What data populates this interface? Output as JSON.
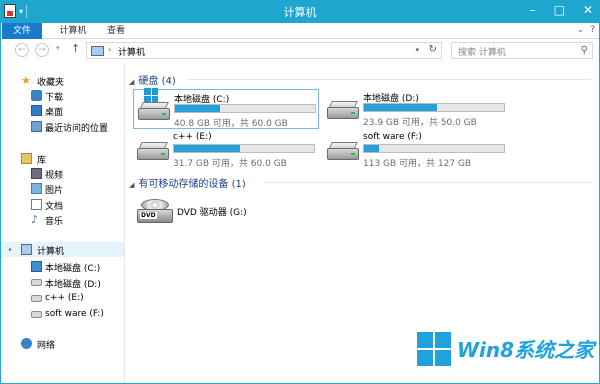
{
  "window": {
    "title": "计算机"
  },
  "ribbon": {
    "tabs": [
      "文件",
      "计算机",
      "查看"
    ]
  },
  "address": {
    "location": "计算机",
    "search_placeholder": "搜索 计算机"
  },
  "nav": {
    "favorites": {
      "label": "收藏夹",
      "items": [
        "下载",
        "桌面",
        "最近访问的位置"
      ]
    },
    "libraries": {
      "label": "库",
      "items": [
        "视频",
        "图片",
        "文档",
        "音乐"
      ]
    },
    "computer": {
      "label": "计算机",
      "items": [
        "本地磁盘 (C:)",
        "本地磁盘 (D:)",
        "c++ (E:)",
        "soft ware (F:)"
      ]
    },
    "network": {
      "label": "网络"
    }
  },
  "groups": {
    "hdd": {
      "label": "硬盘 (4)"
    },
    "removable": {
      "label": "有可移动存储的设备 (1)"
    }
  },
  "drives": [
    {
      "name": "本地磁盘 (C:)",
      "free": "40.8 GB 可用，共 60.0 GB",
      "used_fraction": 0.32
    },
    {
      "name": "本地磁盘 (D:)",
      "free": "23.9 GB 可用，共 50.0 GB",
      "used_fraction": 0.52
    },
    {
      "name": "c++ (E:)",
      "free": "31.7 GB 可用，共 60.0 GB",
      "used_fraction": 0.47
    },
    {
      "name": "soft ware (F:)",
      "free": "113 GB 可用，共 127 GB",
      "used_fraction": 0.11
    }
  ],
  "dvd": {
    "name": "DVD 驱动器 (G:)",
    "badge": "DVD"
  },
  "watermark": {
    "text": "Win8系统之家"
  },
  "colors": {
    "titlebar": "#1fa6cf",
    "file_tab": "#1979ca",
    "bar_fill": "#26a0da",
    "group_head": "#1e3f8a"
  }
}
